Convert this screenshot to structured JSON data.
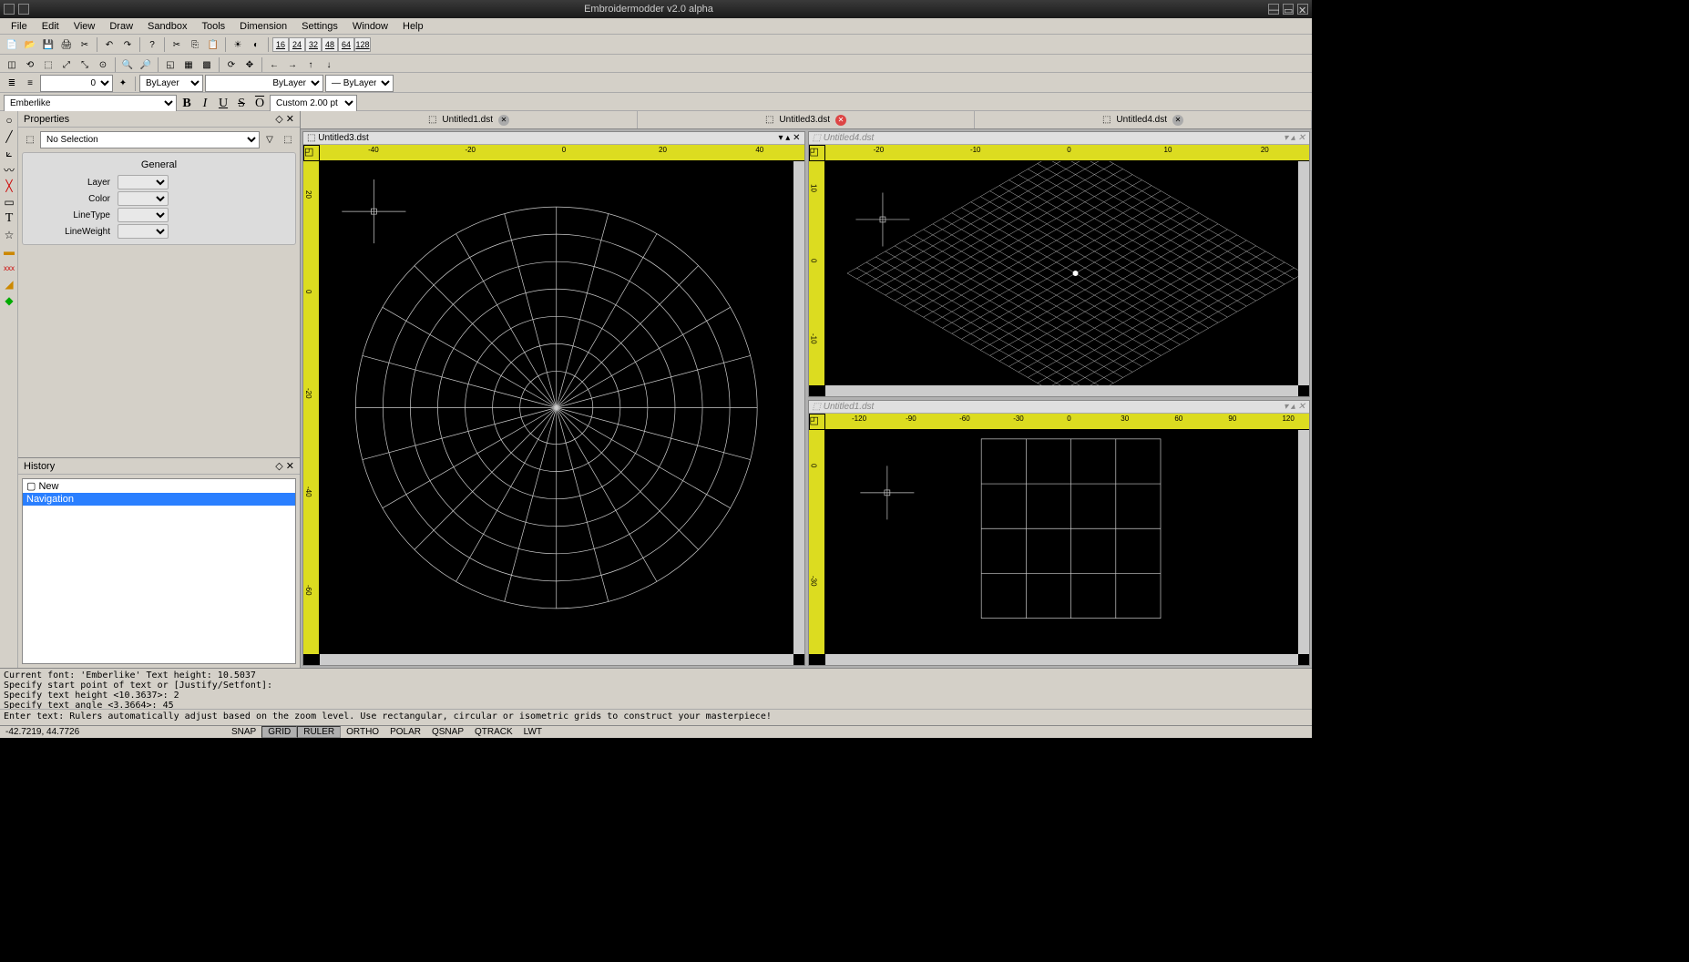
{
  "title": "Embroidermodder v2.0 alpha",
  "menu": [
    "File",
    "Edit",
    "View",
    "Draw",
    "Sandbox",
    "Tools",
    "Dimension",
    "Settings",
    "Window",
    "Help"
  ],
  "sizes": [
    "16",
    "24",
    "32",
    "48",
    "64",
    "128"
  ],
  "layer_spin": "0",
  "bylayer1": "ByLayer",
  "bylayer2": "ByLayer",
  "bylayer3": "ByLayer",
  "font_name": "Emberlike",
  "font_custom": "Custom 2.00 pt",
  "props_title": "Properties",
  "props_sel": "No Selection",
  "props_group": "General",
  "props_rows": [
    "Layer",
    "Color",
    "LineType",
    "LineWeight"
  ],
  "hist_title": "History",
  "hist_items": [
    {
      "label": "New",
      "sel": false,
      "icon": "▢"
    },
    {
      "label": "Navigation",
      "sel": true,
      "icon": ""
    }
  ],
  "tabs": [
    {
      "label": "Untitled1.dst",
      "close": "gray"
    },
    {
      "label": "Untitled3.dst",
      "close": "red"
    },
    {
      "label": "Untitled4.dst",
      "close": "gray"
    }
  ],
  "views": {
    "big": {
      "title": "Untitled3.dst",
      "ticks_h": [
        -40,
        -20,
        0,
        20,
        40
      ],
      "ticks_v": [
        20,
        0,
        -20,
        -40,
        -60
      ]
    },
    "tr": {
      "title": "Untitled4.dst",
      "inactive": true,
      "ticks_h": [
        -20,
        -10,
        0,
        10,
        20
      ],
      "ticks_v": [
        10,
        0,
        -10
      ]
    },
    "br": {
      "title": "Untitled1.dst",
      "inactive": true,
      "ticks_h": [
        -120,
        -90,
        -60,
        -30,
        0,
        30,
        60,
        90,
        120
      ],
      "ticks_v": [
        0,
        -30
      ]
    }
  },
  "console_lines": [
    "Current font: 'Emberlike' Text height: 10.5037",
    "Specify start point of text or [Justify/Setfont]:",
    "Specify text height <10.3637>: 2",
    "Specify text angle <3.3664>: 45"
  ],
  "cmdline": "Enter text: Rulers automatically adjust based on the zoom level. Use rectangular, circular or isometric grids to construct your masterpiece!",
  "coords": "-42.7219, 44.7726",
  "status_btns": [
    {
      "label": "SNAP",
      "active": false
    },
    {
      "label": "GRID",
      "active": true
    },
    {
      "label": "RULER",
      "active": true
    },
    {
      "label": "ORTHO",
      "active": false
    },
    {
      "label": "POLAR",
      "active": false
    },
    {
      "label": "QSNAP",
      "active": false
    },
    {
      "label": "QTRACK",
      "active": false
    },
    {
      "label": "LWT",
      "active": false
    }
  ]
}
